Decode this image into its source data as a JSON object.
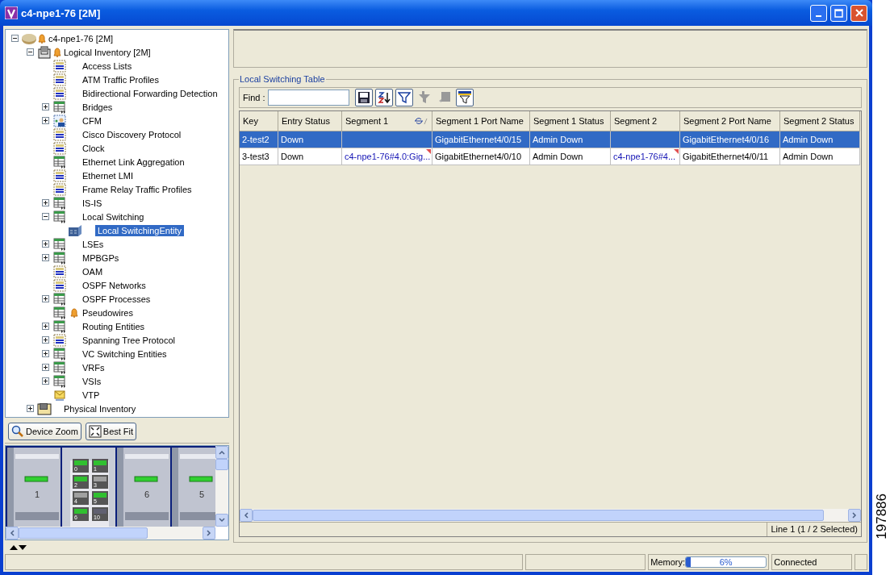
{
  "window": {
    "title": "c4-npe1-76 [2M]"
  },
  "tree": [
    {
      "label": "c4-npe1-76 [2M]",
      "kind": "device",
      "alarm": true,
      "selected": false,
      "expanded": true,
      "children": [
        {
          "label": "Logical Inventory [2M]",
          "kind": "inventory",
          "alarm": true,
          "selected": false,
          "expanded": true,
          "children": [
            {
              "label": "Access Lists",
              "kind": "list",
              "alarm": false,
              "selected": false
            },
            {
              "label": "ATM Traffic Profiles",
              "kind": "list",
              "alarm": false,
              "selected": false
            },
            {
              "label": "Bidirectional Forwarding Detection",
              "kind": "list",
              "alarm": false,
              "selected": false
            },
            {
              "label": "Bridges",
              "kind": "table",
              "alarm": false,
              "selected": false,
              "expanded": false
            },
            {
              "label": "CFM",
              "kind": "cfm",
              "alarm": false,
              "selected": false,
              "expanded": false
            },
            {
              "label": "Cisco Discovery Protocol",
              "kind": "list",
              "alarm": false,
              "selected": false
            },
            {
              "label": "Clock",
              "kind": "list",
              "alarm": false,
              "selected": false
            },
            {
              "label": "Ethernet Link Aggregation",
              "kind": "table",
              "alarm": false,
              "selected": false
            },
            {
              "label": "Ethernet LMI",
              "kind": "list",
              "alarm": false,
              "selected": false
            },
            {
              "label": "Frame Relay Traffic Profiles",
              "kind": "list",
              "alarm": false,
              "selected": false
            },
            {
              "label": "IS-IS",
              "kind": "table",
              "alarm": false,
              "selected": false,
              "expanded": false
            },
            {
              "label": "Local Switching",
              "kind": "table",
              "alarm": false,
              "selected": false,
              "expanded": true,
              "children": [
                {
                  "label": "Local SwitchingEntity",
                  "kind": "entity",
                  "alarm": false,
                  "selected": true
                }
              ]
            },
            {
              "label": "LSEs",
              "kind": "table",
              "alarm": false,
              "selected": false,
              "expanded": false
            },
            {
              "label": "MPBGPs",
              "kind": "table",
              "alarm": false,
              "selected": false,
              "expanded": false
            },
            {
              "label": "OAM",
              "kind": "list",
              "alarm": false,
              "selected": false
            },
            {
              "label": "OSPF Networks",
              "kind": "list",
              "alarm": false,
              "selected": false
            },
            {
              "label": "OSPF Processes",
              "kind": "table",
              "alarm": false,
              "selected": false,
              "expanded": false
            },
            {
              "label": "Pseudowires",
              "kind": "table",
              "alarm": true,
              "selected": false
            },
            {
              "label": "Routing Entities",
              "kind": "table",
              "alarm": false,
              "selected": false,
              "expanded": false
            },
            {
              "label": "Spanning Tree Protocol",
              "kind": "list",
              "alarm": false,
              "selected": false,
              "expanded": false
            },
            {
              "label": "VC Switching Entities",
              "kind": "table",
              "alarm": false,
              "selected": false,
              "expanded": false
            },
            {
              "label": "VRFs",
              "kind": "table",
              "alarm": false,
              "selected": false,
              "expanded": false
            },
            {
              "label": "VSIs",
              "kind": "table",
              "alarm": false,
              "selected": false,
              "expanded": false
            },
            {
              "label": "VTP",
              "kind": "vtp",
              "alarm": false,
              "selected": false
            }
          ]
        },
        {
          "label": "Physical Inventory",
          "kind": "rack",
          "alarm": false,
          "selected": false,
          "expanded": false
        }
      ]
    }
  ],
  "zoom_buttons": [
    {
      "label": "Device Zoom",
      "kind": "magnifier"
    },
    {
      "label": "Best Fit",
      "kind": "fit"
    }
  ],
  "device_view": {
    "slots": [
      {
        "kind": "module",
        "label": "1"
      },
      {
        "kind": "ports",
        "ports": [
          {
            "label": "0",
            "kind": "active"
          },
          {
            "label": "1",
            "kind": "active"
          },
          {
            "label": "2",
            "kind": "active"
          },
          {
            "label": "3",
            "kind": "inactive"
          },
          {
            "label": "4",
            "kind": "inactive"
          },
          {
            "label": "5",
            "kind": "active"
          },
          {
            "label": "6",
            "kind": "active"
          },
          {
            "label": "10",
            "kind": "link"
          }
        ]
      },
      {
        "kind": "module",
        "label": "6"
      },
      {
        "kind": "module",
        "label": "5"
      }
    ]
  },
  "table_group": {
    "title": "Local Switching Table",
    "find_label": "Find :",
    "tools": [
      {
        "kind": "save",
        "disabled": false
      },
      {
        "kind": "sort",
        "disabled": false
      },
      {
        "kind": "filter",
        "disabled": false
      },
      {
        "kind": "clear-filter",
        "disabled": true
      },
      {
        "kind": "remove",
        "disabled": true
      },
      {
        "kind": "filter-settings",
        "disabled": false
      }
    ],
    "columns": [
      {
        "label": "Key",
        "sorted": false
      },
      {
        "label": "Entry Status",
        "sorted": false
      },
      {
        "label": "Segment 1",
        "sorted": true
      },
      {
        "label": "Segment 1 Port Name",
        "sorted": false
      },
      {
        "label": "Segment 1 Status",
        "sorted": false
      },
      {
        "label": "Segment 2",
        "sorted": false
      },
      {
        "label": "Segment 2 Port Name",
        "sorted": false
      },
      {
        "label": "Segment 2 Status",
        "sorted": false
      }
    ],
    "rows": [
      {
        "selected": true,
        "cells": [
          {
            "kind": "plain",
            "text": "2-test2"
          },
          {
            "kind": "plain",
            "text": "Down"
          },
          {
            "kind": "plain"
          },
          {
            "kind": "plain",
            "text": "GigabitEthernet4/0/15"
          },
          {
            "kind": "plain",
            "text": "Admin Down"
          },
          {
            "kind": "plain"
          },
          {
            "kind": "plain",
            "text": "GigabitEthernet4/0/16"
          },
          {
            "kind": "plain",
            "text": "Admin Down"
          }
        ]
      },
      {
        "selected": false,
        "cells": [
          {
            "kind": "plain",
            "text": "3-test3"
          },
          {
            "kind": "plain",
            "text": "Down"
          },
          {
            "kind": "link",
            "text": "c4-npe1-76#4.0:Gig..."
          },
          {
            "kind": "plain",
            "text": "GigabitEthernet4/0/10"
          },
          {
            "kind": "plain",
            "text": "Admin Down"
          },
          {
            "kind": "link",
            "text": "c4-npe1-76#4..."
          },
          {
            "kind": "plain",
            "text": "GigabitEthernet4/0/11"
          },
          {
            "kind": "plain",
            "text": "Admin Down"
          }
        ]
      }
    ],
    "footer": "Line 1 (1 / 2 Selected)"
  },
  "status_bar": {
    "memory_label": "Memory:",
    "memory": {
      "level": 0.06,
      "reading": "6%"
    },
    "connection": "Connected"
  },
  "figure_number": "197886"
}
